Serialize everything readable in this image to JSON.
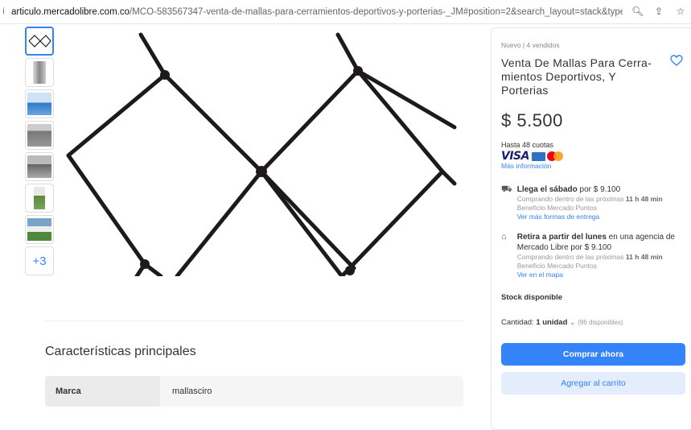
{
  "browser": {
    "url_domain": "articulo.mercadolibre.com.co",
    "url_path": "/MCO-583567347-venta-de-mallas-para-cerramientos-deportivos-y-porterias-_JM#position=2&search_layout=stack&type..."
  },
  "gallery": {
    "more_label": "+3"
  },
  "features": {
    "title": "Características principales",
    "rows": [
      {
        "key": "Marca",
        "value": "mallasciro"
      }
    ]
  },
  "product": {
    "meta": "Nuevo  |  4 vendidos",
    "title": "Venta De Mallas Para Cerra- mientos Deportivos, Y Porterias",
    "price": "$ 5.500",
    "installments": "Hasta 48 cuotas",
    "card_brand": "VISA",
    "more_info": "Más información"
  },
  "shipping": {
    "line_prefix": "Llega el sábado",
    "line_suffix": " por $ 9.100",
    "detail_prefix": "Comprando dentro de las próximas ",
    "detail_time": "11 h 48 min",
    "benefit": "Beneficio Mercado Puntos",
    "link": "Ver más formas de entrega"
  },
  "pickup": {
    "line_prefix": "Retira a partir del lunes",
    "line_suffix": " en una agencia de Mercado Libre por $ 9.100",
    "detail_prefix": "Comprando dentro de las próximas ",
    "detail_time": "11 h 48 min",
    "benefit": "Beneficio Mercado Puntos",
    "link": "Ver en el mapa"
  },
  "stock": {
    "label": "Stock disponible",
    "qty_label": "Cantidad: ",
    "qty_value": "1 unidad",
    "available": "(96 disponibles)"
  },
  "actions": {
    "buy": "Comprar ahora",
    "cart": "Agregar al carrito"
  },
  "colors": {
    "accent": "#3483fa",
    "accent_light": "#e3edfb"
  },
  "icons": [
    "lock-icon",
    "zoom-icon",
    "share-icon",
    "bookmark-star-icon",
    "heart-icon",
    "truck-icon",
    "store-icon",
    "chevron-down-icon"
  ]
}
